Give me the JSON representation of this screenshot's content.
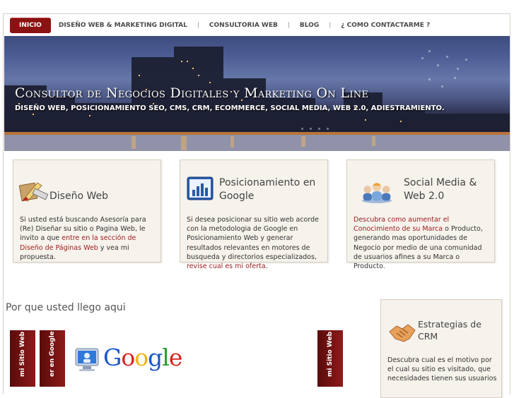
{
  "nav": {
    "items": [
      {
        "label": "INICIO",
        "active": true
      },
      {
        "label": "DISEÑO WEB & MARKETING DIGITAL"
      },
      {
        "label": "CONSULTORIA WEB"
      },
      {
        "label": "BLOG"
      },
      {
        "label": "¿ COMO CONTACTARME ?"
      }
    ],
    "separator": "|"
  },
  "hero": {
    "title": "Consultor de Negocios Digitales y Marketing On Line",
    "subtitle": "DISEÑO WEB, POSICIONAMIENTO SEO, CMS, CRM, ECOMMERCE, SOCIAL MEDIA, WEB 2.0, ADIESTRAMIENTO."
  },
  "features": {
    "diseno": {
      "icon": "design-tools-icon",
      "title": "Diseño Web",
      "text_1": "Si usted está buscando Asesoría para (Re) Diseñar su sitio o Pagina Web, le invito a que ",
      "link": "entre en la sección de Diseño de Páginas Web",
      "text_2": " y vea mi propuesta."
    },
    "posicionamiento": {
      "icon": "bar-chart-icon",
      "title_1": "Posicionamiento en",
      "title_2": "Google",
      "text_1": "Si desea posicionar su sitio web acorde con la metodologia de Google en Posicionamiento Web y generar resultados relevantes en motores de busqueda y directorios especializados, ",
      "link": "revise cual es mi oferta",
      "text_2": "."
    },
    "social": {
      "icon": "users-group-icon",
      "title_1": "Social Media &",
      "title_2": "Web 2.0",
      "link": "Descubra como aumentar el Conocimiento de su Marca",
      "text_2": " o Producto, generando mas oportunidades de Negocio por medio de una comunidad de usuarios afines a su Marca o Producto."
    }
  },
  "lower": {
    "section_title": "Por que usted llego aqui",
    "tabs": [
      "mi Sitio Web",
      "er en Google",
      "mi Sitio Web"
    ],
    "google_logo": [
      "G",
      "o",
      "o",
      "g",
      "l",
      "e"
    ],
    "google_colors": [
      "#1a57c8",
      "#d8231e",
      "#f3b310",
      "#1a57c8",
      "#2a9b2a",
      "#d8231e"
    ]
  },
  "crm": {
    "icon": "handshake-icon",
    "title_1": "Estrategias de",
    "title_2": "CRM",
    "text": "Descubra cual es el motivo por el cual su sitio es visitado, que necesidades tienen sus usuarios"
  },
  "colors": {
    "accent": "#8b1212",
    "link": "#9b1b1b",
    "box_bg": "#f6f2ec"
  }
}
